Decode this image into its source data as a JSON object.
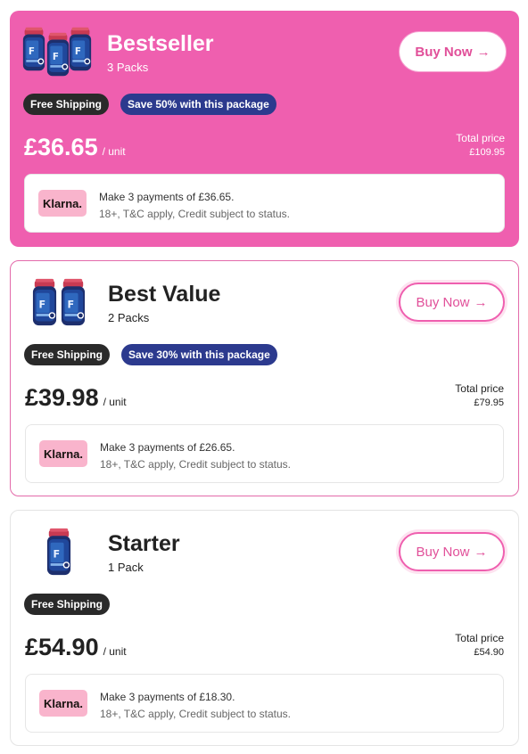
{
  "colors": {
    "brand_pink": "#ef5faf",
    "navy_badge": "#2c3a8e",
    "dark_badge": "#2a2a2a",
    "klarna_pink": "#f9b4cc"
  },
  "packages": [
    {
      "title": "Bestseller",
      "subtitle": "3 Packs",
      "buy_label": "Buy Now",
      "buy_arrow": "→",
      "badges": [
        "Free Shipping",
        "Save 50% with this package"
      ],
      "price": "£36.65",
      "unit": "/ unit",
      "total_label": "Total price",
      "total_value": "£109.95",
      "klarna_logo": "Klarna.",
      "klarna_line1": "Make 3 payments of £36.65.",
      "klarna_line2": "18+, T&C apply, Credit subject to status.",
      "product_icon": "supplement-jar-icon"
    },
    {
      "title": "Best Value",
      "subtitle": "2 Packs",
      "buy_label": "Buy Now",
      "buy_arrow": "→",
      "badges": [
        "Free Shipping",
        "Save 30% with this package"
      ],
      "price": "£39.98",
      "unit": "/ unit",
      "total_label": "Total price",
      "total_value": "£79.95",
      "klarna_logo": "Klarna.",
      "klarna_line1": "Make 3 payments of £26.65.",
      "klarna_line2": "18+, T&C apply, Credit subject to status.",
      "product_icon": "supplement-jar-icon"
    },
    {
      "title": "Starter",
      "subtitle": "1 Pack",
      "buy_label": "Buy Now",
      "buy_arrow": "→",
      "badges": [
        "Free Shipping"
      ],
      "price": "£54.90",
      "unit": "/ unit",
      "total_label": "Total price",
      "total_value": "£54.90",
      "klarna_logo": "Klarna.",
      "klarna_line1": "Make 3 payments of £18.30.",
      "klarna_line2": "18+, T&C apply, Credit subject to status.",
      "product_icon": "supplement-jar-icon"
    }
  ]
}
